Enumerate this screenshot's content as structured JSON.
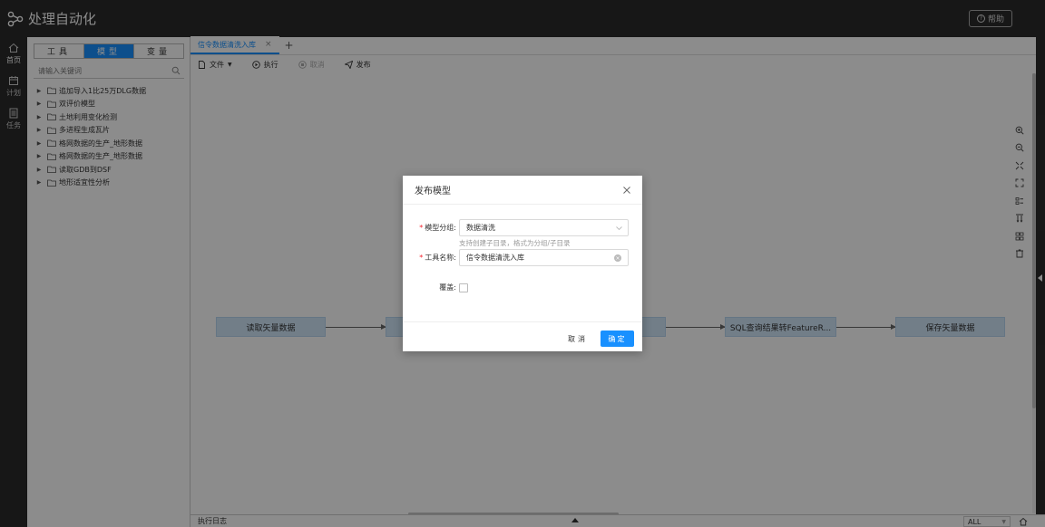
{
  "header": {
    "app_title": "处理自动化",
    "help_label": "帮助"
  },
  "nav": [
    {
      "label": "首页",
      "icon": "home-icon"
    },
    {
      "label": "计划",
      "icon": "calendar-icon"
    },
    {
      "label": "任务",
      "icon": "list-icon"
    }
  ],
  "panel": {
    "tabs": [
      "工具",
      "模型",
      "变量"
    ],
    "active_tab": "模型",
    "search_placeholder": "请输入关键词",
    "tree": [
      "追加导入1比25万DLG数据",
      "双评价模型",
      "土地利用变化检测",
      "多进程生成瓦片",
      "格网数据的生产_地形数据",
      "格网数据的生产_地形数据",
      "读取GDB到DSF",
      "地形适宜性分析"
    ]
  },
  "editor": {
    "tab_label": "信令数据清洗入库",
    "toolbar": {
      "file": "文件",
      "run": "执行",
      "cancel": "取消",
      "publish": "发布"
    },
    "nodes": [
      {
        "label": "读取矢量数据"
      },
      {
        "label": ""
      },
      {
        "label": ""
      },
      {
        "label": "SQL查询结果转FeatureR..."
      },
      {
        "label": "保存矢量数据"
      }
    ],
    "log_title": "执行日志",
    "log_level": "ALL"
  },
  "modal": {
    "title": "发布模型",
    "group_label": "模型分组:",
    "group_value": "数据清洗",
    "group_hint": "支持创建子目录，格式为分组/子目录",
    "name_label": "工具名称:",
    "name_value": "信令数据清洗入库",
    "overwrite_label": "覆盖:",
    "cancel_label": "取消",
    "ok_label": "确定"
  },
  "colors": {
    "primary": "#1890ff",
    "dark": "#2b2b2b",
    "node_fill": "#cfe5f8"
  }
}
